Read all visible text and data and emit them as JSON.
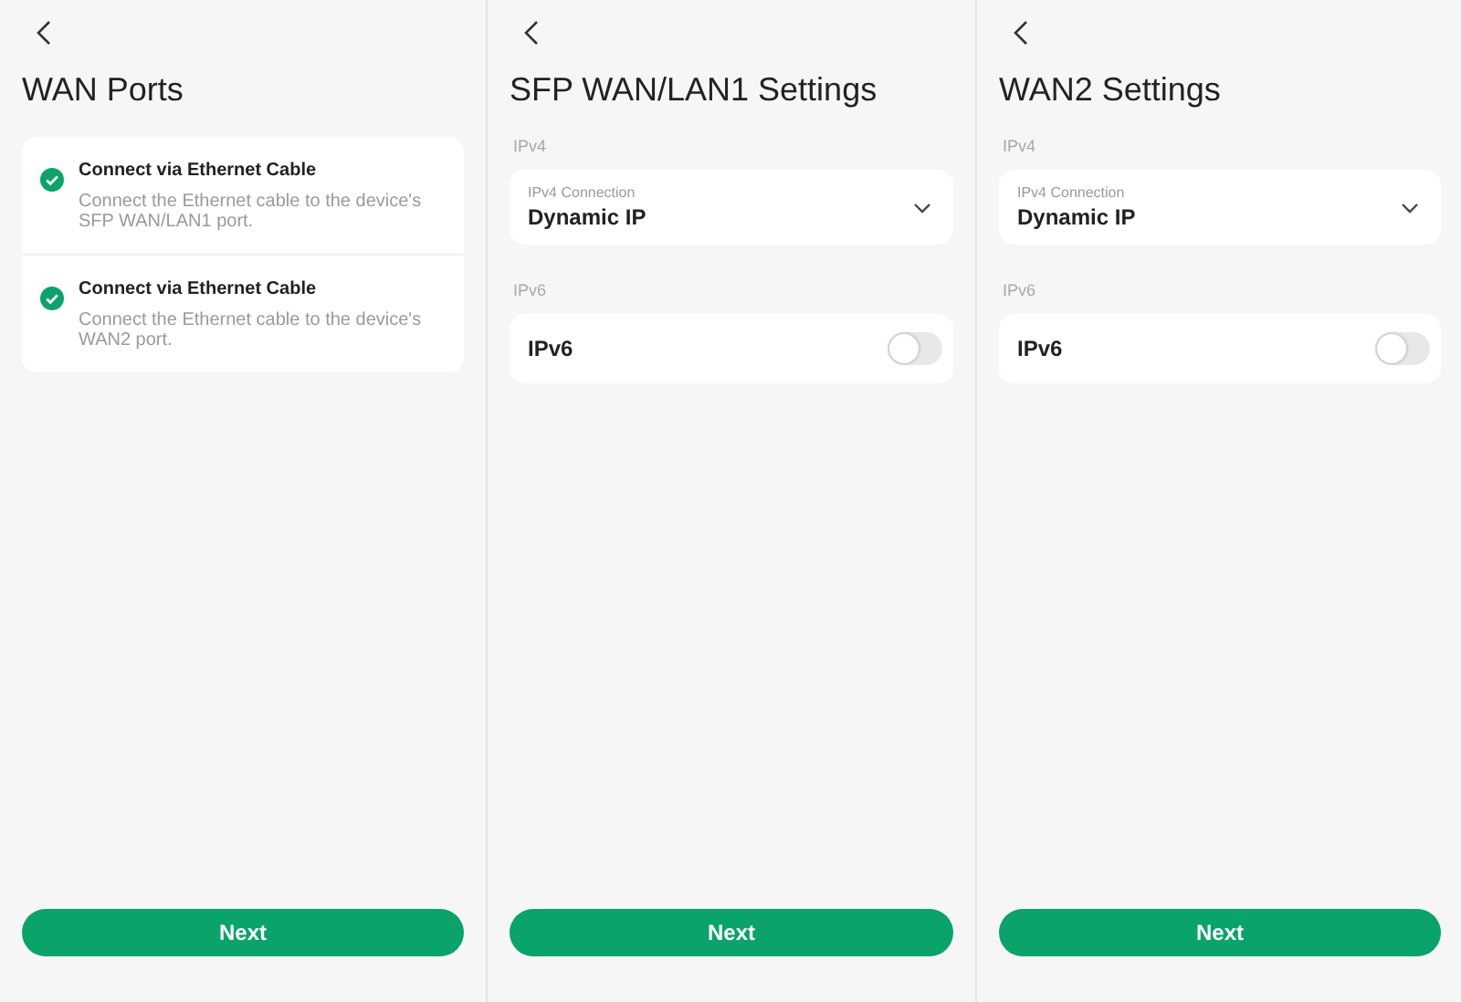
{
  "screens": [
    {
      "kind": "ports",
      "title": "WAN Ports",
      "steps": [
        {
          "title": "Connect via Ethernet Cable",
          "description": "Connect the Ethernet cable to the device's SFP WAN/LAN1 port.",
          "done": true
        },
        {
          "title": "Connect via Ethernet Cable",
          "description": "Connect the Ethernet cable to the device's WAN2 port.",
          "done": true
        }
      ],
      "button": "Next"
    },
    {
      "kind": "settings",
      "title": "SFP WAN/LAN1 Settings",
      "ipv4_label": "IPv4",
      "connection": {
        "label": "IPv4 Connection",
        "value": "Dynamic IP"
      },
      "ipv6_label": "IPv6",
      "ipv6": {
        "label": "IPv6",
        "on": false
      },
      "button": "Next"
    },
    {
      "kind": "settings",
      "title": "WAN2 Settings",
      "ipv4_label": "IPv4",
      "connection": {
        "label": "IPv4 Connection",
        "value": "Dynamic IP"
      },
      "ipv6_label": "IPv6",
      "ipv6": {
        "label": "IPv6",
        "on": false
      },
      "button": "Next"
    }
  ]
}
